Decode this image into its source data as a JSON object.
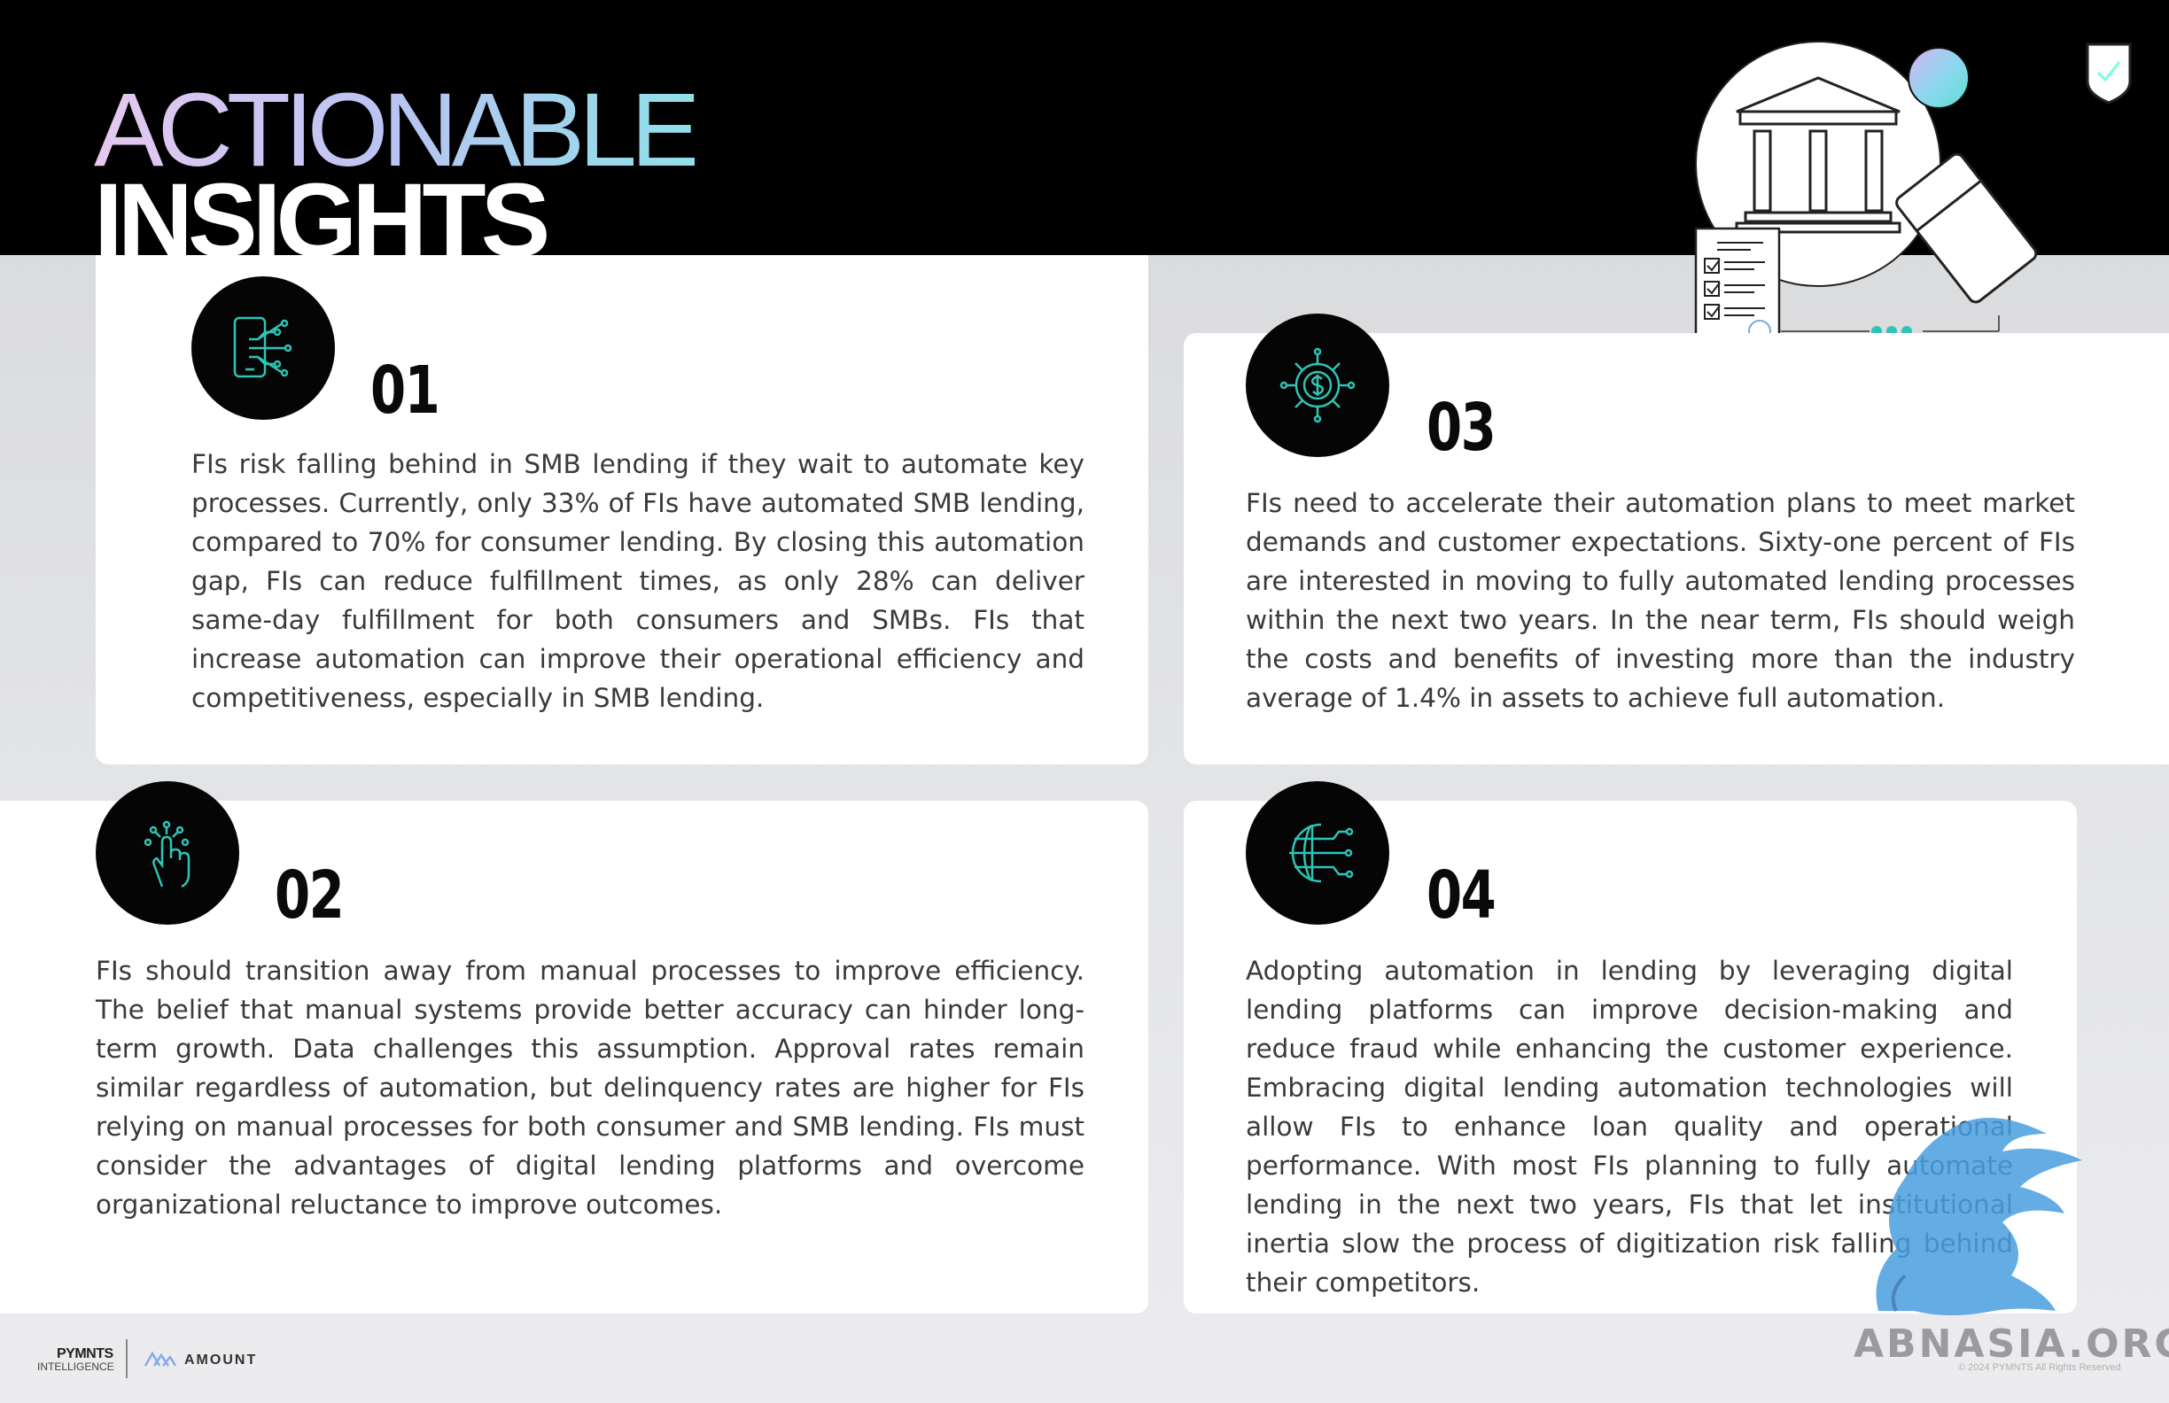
{
  "header": {
    "title_line1": "ACTIONABLE",
    "title_line2": "INSIGHTS"
  },
  "insights": [
    {
      "number": "01",
      "icon": "mobile-network-icon",
      "text": "FIs risk falling behind in SMB lending if they wait to automate key processes. Currently, only 33% of FIs have automated SMB lending, compared to 70% for consumer lending. By closing this automation gap, FIs can reduce fulfillment times, as only 28% can deliver same-day fulfillment for both consumers and SMBs. FIs that increase automation can improve their operational efficiency and competitiveness, especially in SMB lending."
    },
    {
      "number": "02",
      "icon": "hand-touch-icon",
      "text": "FIs should transition away from manual processes to improve efficiency. The belief that manual systems provide better accuracy can hinder long-term growth. Data challenges this assumption. Approval rates remain similar regardless of automation, but delinquency rates are higher for FIs relying on manual processes for both consumer and SMB lending. FIs must consider the advantages of digital lending platforms and overcome organizational reluctance to improve outcomes."
    },
    {
      "number": "03",
      "icon": "dollar-network-icon",
      "text": "FIs need to accelerate their automation plans to meet market demands and customer expectations. Sixty-one percent of FIs are interested in moving to fully automated lending processes within the next two years. In the near term, FIs should weigh the costs and benefits of investing more than the industry average of 1.4% in assets to achieve full automation."
    },
    {
      "number": "04",
      "icon": "globe-network-icon",
      "text": "Adopting automation in lending by leveraging digital lending platforms can improve decision-making and reduce fraud while enhancing the customer experience. Embracing digital lending automation technologies will allow FIs to enhance loan quality and operational performance. With most FIs planning to fully automate lending in the next two years, FIs that let institutional inertia slow the process of digitization risk falling behind their competitors."
    }
  ],
  "footer": {
    "brand_primary": "PYMNTS",
    "brand_secondary": "INTELLIGENCE",
    "partner": "AMOUNT",
    "copyright": "© 2024 PYMNTS All Rights Reserved",
    "watermark": "ABNASIA.ORG"
  },
  "colors": {
    "accent_teal": "#2ec4b6",
    "header_bg": "#000000",
    "card_bg": "#ffffff"
  }
}
